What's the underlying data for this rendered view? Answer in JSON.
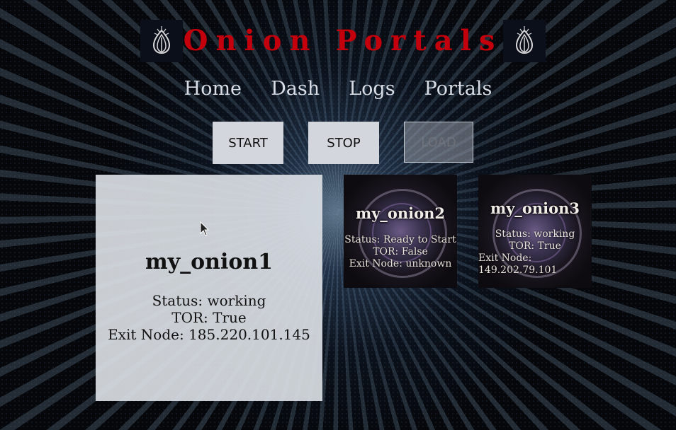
{
  "app": {
    "title": "Onion Portals"
  },
  "nav": {
    "items": [
      "Home",
      "Dash",
      "Logs",
      "Portals"
    ]
  },
  "controls": {
    "start": "START",
    "stop": "STOP",
    "load": "LOAD"
  },
  "portals": [
    {
      "name": "my_onion1",
      "status": "Status: working",
      "tor": "TOR: True",
      "exit": "Exit Node: 185.220.101.145"
    },
    {
      "name": "my_onion2",
      "status": "Status: Ready to Start",
      "tor": "TOR: False",
      "exit": "Exit Node: unknown"
    },
    {
      "name": "my_onion3",
      "status": "Status: working",
      "tor": "TOR: True",
      "exit_label": "Exit Node:",
      "exit_value": "149.202.79.101"
    }
  ],
  "colors": {
    "title": "#c4000c",
    "nav": "#d8dde6"
  },
  "icons": {
    "logo": "onion-logo-icon",
    "cursor": "mouse-pointer-icon"
  }
}
